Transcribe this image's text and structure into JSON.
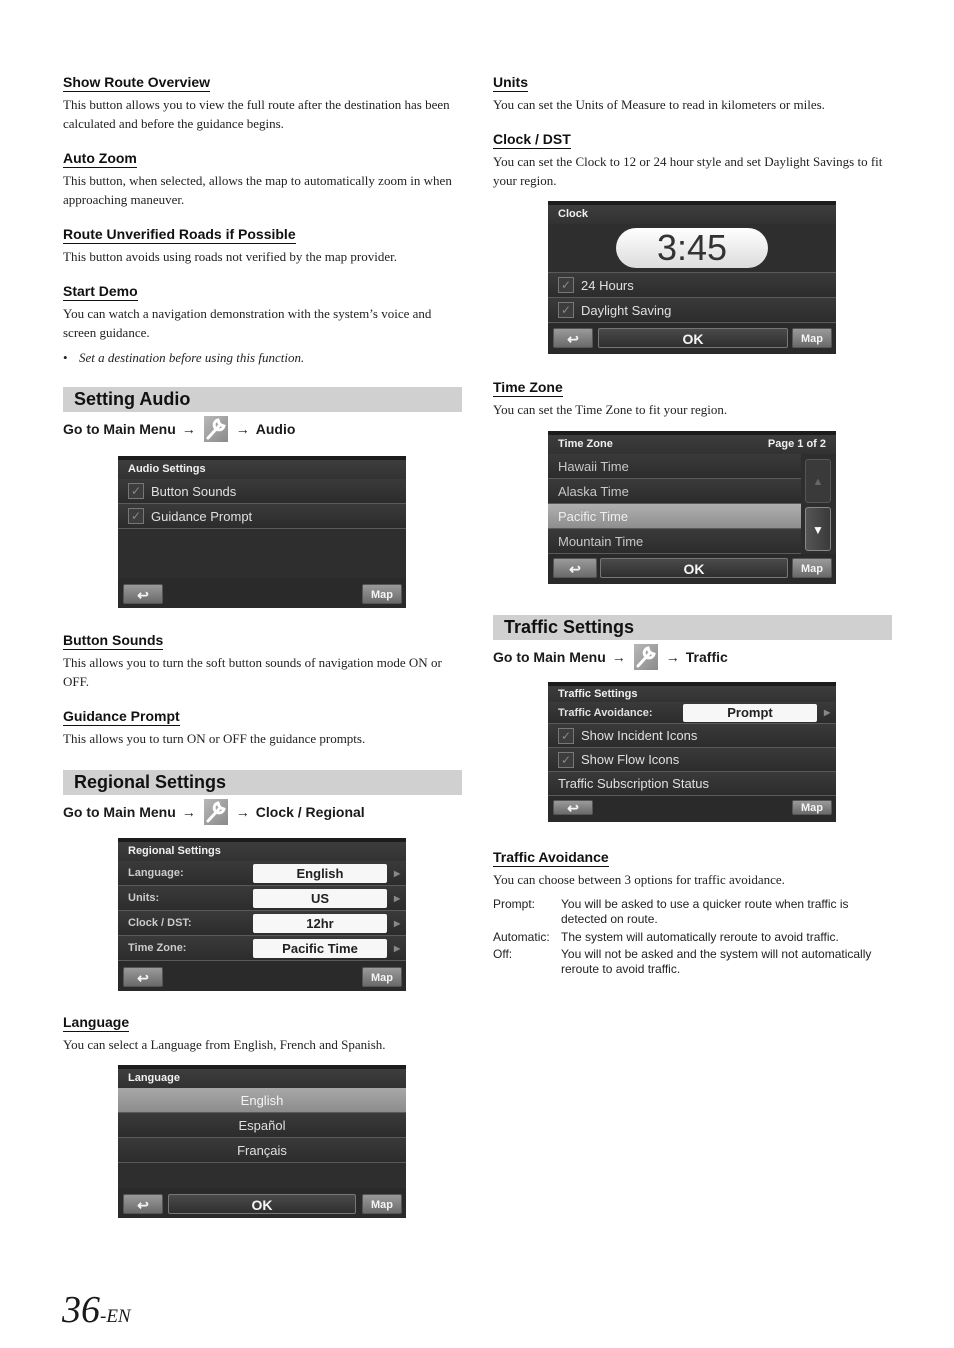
{
  "left": {
    "show_route_overview": {
      "title": "Show Route Overview",
      "body": "This button allows you to view the full route after the destination has been calculated and before the guidance begins."
    },
    "auto_zoom": {
      "title": "Auto Zoom",
      "body": "This button, when selected, allows the map to automatically zoom in when approaching maneuver."
    },
    "route_unverified": {
      "title": "Route Unverified Roads if Possible",
      "body": "This button avoids using roads not verified by the map provider."
    },
    "start_demo": {
      "title": "Start Demo",
      "body": "You can watch a navigation demonstration with the system’s voice and screen guidance.",
      "note": "Set a destination before using this function."
    },
    "setting_audio": {
      "section_title": "Setting Audio",
      "goto_prefix": "Go to Main Menu",
      "goto_target": "Audio",
      "screen": {
        "title": "Audio Settings",
        "items": [
          {
            "label": "Button Sounds",
            "checked": true
          },
          {
            "label": "Guidance Prompt",
            "checked": true
          }
        ],
        "back_icon": "↩",
        "map_label": "Map"
      }
    },
    "button_sounds": {
      "title": "Button Sounds",
      "body": "This allows you to turn the soft button sounds of navigation mode ON or OFF."
    },
    "guidance_prompt": {
      "title": "Guidance Prompt",
      "body": "This allows you to turn ON or OFF the guidance prompts."
    },
    "regional_settings": {
      "section_title": "Regional Settings",
      "goto_prefix": "Go to Main Menu",
      "goto_target": "Clock / Regional",
      "screen": {
        "title": "Regional Settings",
        "rows": [
          {
            "label": "Language:",
            "value": "English"
          },
          {
            "label": "Units:",
            "value": "US"
          },
          {
            "label": "Clock / DST:",
            "value": "12hr"
          },
          {
            "label": "Time Zone:",
            "value": "Pacific Time"
          }
        ],
        "back_icon": "↩",
        "map_label": "Map"
      }
    },
    "language": {
      "title": "Language",
      "body": "You can select a Language from English, French and Spanish.",
      "screen": {
        "title": "Language",
        "options": [
          "English",
          "Español",
          "Français"
        ],
        "selected": "English",
        "back_icon": "↩",
        "ok_label": "OK",
        "map_label": "Map"
      }
    }
  },
  "right": {
    "units": {
      "title": "Units",
      "body": "You can set the Units of Measure to read in kilometers or miles."
    },
    "clock_dst": {
      "title": "Clock / DST",
      "body": "You can set the Clock to 12 or 24 hour style and set Daylight Savings to fit your region.",
      "screen": {
        "title": "Clock",
        "time": "3:45",
        "options": [
          {
            "label": "24 Hours",
            "checked": true
          },
          {
            "label": "Daylight Saving",
            "checked": true
          }
        ],
        "back_icon": "↩",
        "ok_label": "OK",
        "map_label": "Map"
      }
    },
    "time_zone": {
      "title": "Time Zone",
      "body": "You can set the Time Zone to fit your region.",
      "screen": {
        "title": "Time Zone",
        "page_label": "Page 1 of 2",
        "options": [
          "Hawaii Time",
          "Alaska Time",
          "Pacific Time",
          "Mountain Time"
        ],
        "selected": "Pacific Time",
        "back_icon": "↩",
        "ok_label": "OK",
        "map_label": "Map"
      }
    },
    "traffic_settings": {
      "section_title": "Traffic Settings",
      "goto_prefix": "Go to Main Menu",
      "goto_target": "Traffic",
      "screen": {
        "title": "Traffic Settings",
        "avoidance_label": "Traffic Avoidance:",
        "avoidance_value": "Prompt",
        "items": [
          {
            "label": "Show Incident Icons",
            "checked": true
          },
          {
            "label": "Show Flow Icons",
            "checked": true
          }
        ],
        "subscription_label": "Traffic Subscription Status",
        "back_icon": "↩",
        "map_label": "Map"
      }
    },
    "traffic_avoidance": {
      "title": "Traffic Avoidance",
      "body": "You can choose between 3 options for traffic avoidance.",
      "options": [
        {
          "key": "Prompt:",
          "desc": "You will be asked to use a quicker route when traffic is detected on route."
        },
        {
          "key": "Automatic:",
          "desc": "The system will automatically reroute to avoid traffic."
        },
        {
          "key": "Off:",
          "desc": "You will not be asked and the system will not automatically reroute to avoid traffic."
        }
      ]
    }
  },
  "arrow_glyph": "→",
  "check_glyph": "✓",
  "page_number": "36",
  "page_suffix": "-EN"
}
